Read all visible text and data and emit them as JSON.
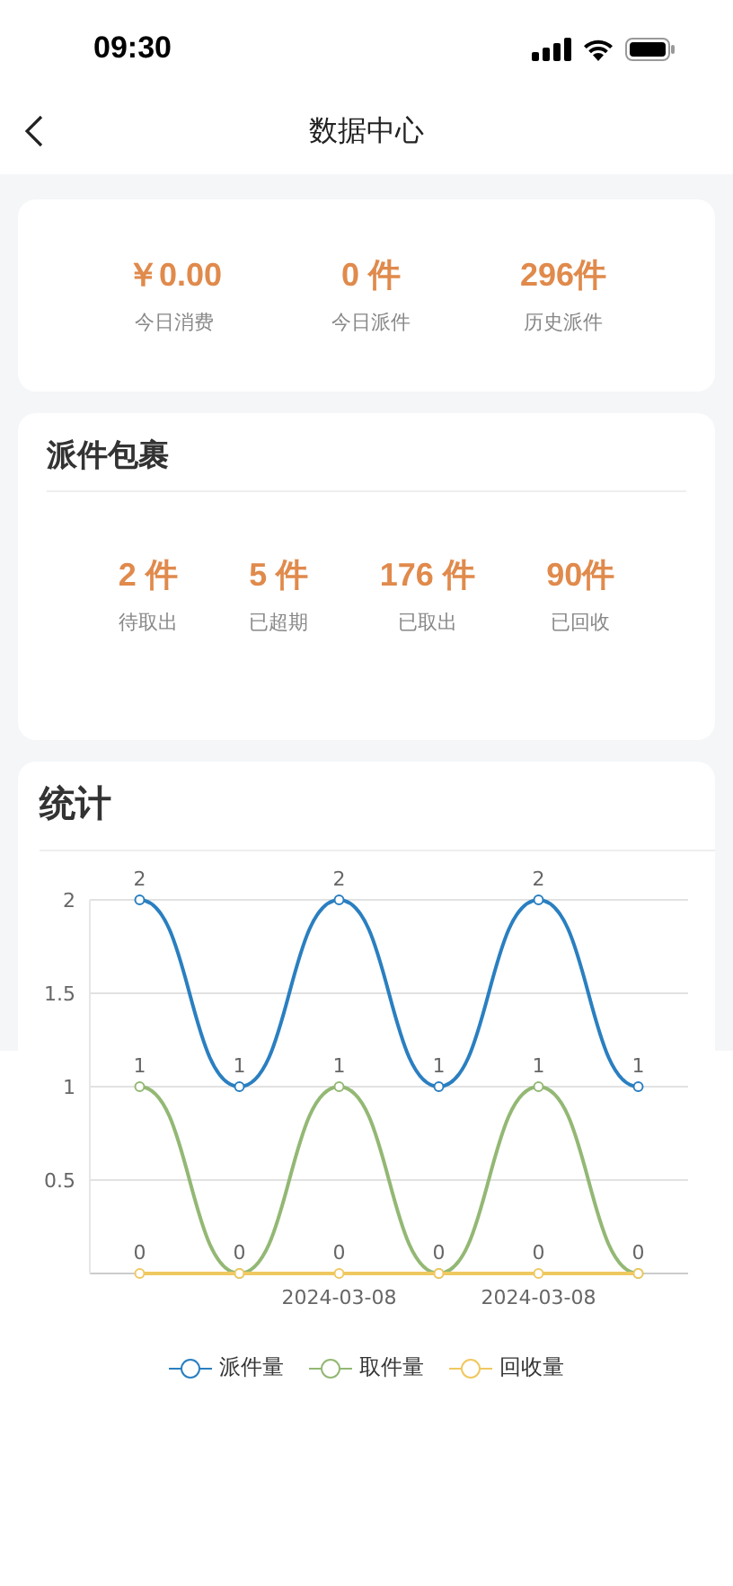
{
  "status_bar": {
    "time": "09:30"
  },
  "nav": {
    "title": "数据中心"
  },
  "summary": [
    {
      "value": "￥0.00",
      "label": "今日消费"
    },
    {
      "value": "0 件",
      "label": "今日派件"
    },
    {
      "value": "296件",
      "label": "历史派件"
    }
  ],
  "parcels": {
    "title": "派件包裹",
    "stats": [
      {
        "value": "2 件",
        "label": "待取出"
      },
      {
        "value": "5 件",
        "label": "已超期"
      },
      {
        "value": "176 件",
        "label": "已取出"
      },
      {
        "value": "90件",
        "label": "已回收"
      }
    ]
  },
  "statistics": {
    "title": "统计",
    "chart_data": {
      "type": "line",
      "categories": [
        null,
        null,
        "2024-03-08",
        null,
        "2024-03-08",
        null
      ],
      "ylim": [
        0,
        2
      ],
      "yticks": [
        0.5,
        1,
        1.5,
        2
      ],
      "grid": true,
      "legend": "bottom",
      "value_labels": [
        [
          "2",
          "1",
          "2",
          "1",
          "2",
          "1"
        ],
        [
          "1",
          "0",
          "1",
          "0",
          "1",
          "0"
        ],
        [
          "0",
          null,
          "0",
          null,
          "0",
          null
        ]
      ],
      "series": [
        {
          "name": "派件量",
          "color": "#2a7fc0",
          "marker": "circle",
          "values": [
            2,
            1,
            2,
            1,
            2,
            1
          ]
        },
        {
          "name": "取件量",
          "color": "#93b874",
          "marker": "circle",
          "values": [
            1,
            0,
            1,
            0,
            1,
            0
          ]
        },
        {
          "name": "回收量",
          "color": "#f0c860",
          "marker": "circle",
          "values": [
            0,
            0,
            0,
            0,
            0,
            0
          ]
        }
      ]
    }
  }
}
